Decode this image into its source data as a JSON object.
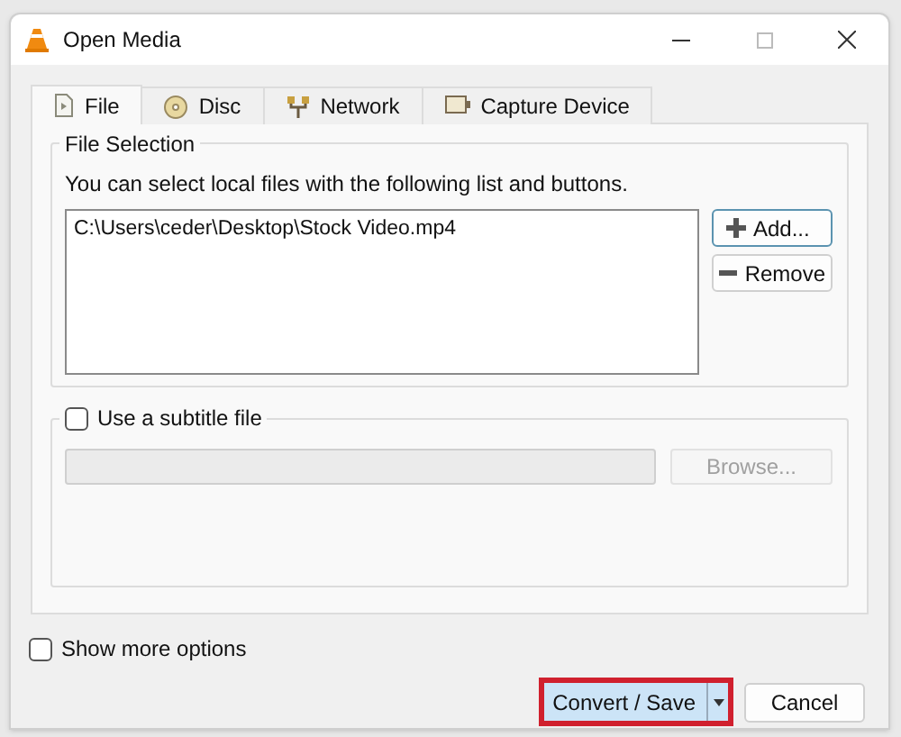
{
  "window": {
    "title": "Open Media"
  },
  "tabs": [
    {
      "label": "File",
      "kind": "file",
      "selected": true
    },
    {
      "label": "Disc",
      "kind": "disc",
      "selected": false
    },
    {
      "label": "Network",
      "kind": "network",
      "selected": false
    },
    {
      "label": "Capture Device",
      "kind": "capture",
      "selected": false
    }
  ],
  "file_selection": {
    "title": "File Selection",
    "description": "You can select local files with the following list and buttons.",
    "files": [
      "C:\\Users\\ceder\\Desktop\\Stock Video.mp4"
    ],
    "add_button": "Add...",
    "remove_button": "Remove"
  },
  "subtitle": {
    "label": "Use a subtitle file",
    "checked": false,
    "browse_button": "Browse...",
    "disabled": true
  },
  "show_more_options": {
    "label": "Show more options",
    "checked": false
  },
  "buttons": {
    "convert": {
      "label": "Convert / Save",
      "highlighted": true
    },
    "cancel": "Cancel"
  }
}
